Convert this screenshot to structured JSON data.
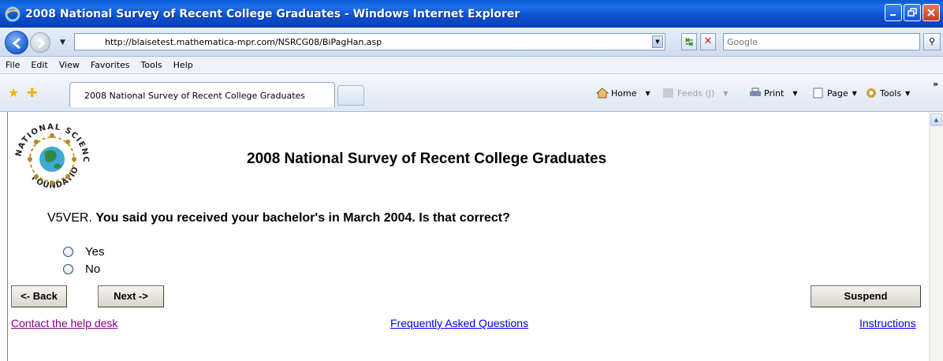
{
  "window": {
    "title": "2008 National Survey of Recent College Graduates - Windows Internet Explorer"
  },
  "address_bar": {
    "url": "http://blaisetest.mathematica-mpr.com/NSRCG08/BiPagHan.asp",
    "search_placeholder": "Google"
  },
  "menu": {
    "items": [
      "File",
      "Edit",
      "View",
      "Favorites",
      "Tools",
      "Help"
    ]
  },
  "tabs": {
    "active_tab_label": "2008 National Survey of Recent College Graduates"
  },
  "command_bar": {
    "home_label": "Home",
    "feeds_label": "Feeds (J)",
    "print_label": "Print",
    "page_label": "Page",
    "tools_label": "Tools"
  },
  "page": {
    "logo_text_top": "NATIONAL SCIENCE",
    "logo_text_bottom": "FOUNDATION",
    "title": "2008 National Survey of Recent College Graduates",
    "question_id": "V5VER.",
    "question_text": "You said you received your bachelor's in March 2004. Is that correct?",
    "options": [
      "Yes",
      "No"
    ],
    "buttons": {
      "back": "<- Back",
      "next": "Next ->",
      "suspend": "Suspend"
    },
    "links": {
      "help_desk": "Contact the help desk",
      "faq": "Frequently Asked Questions",
      "instructions": "Instructions"
    }
  },
  "colors": {
    "titlebar": "#0a5ad6",
    "visited_link": "#800080",
    "link": "#0000ee"
  }
}
